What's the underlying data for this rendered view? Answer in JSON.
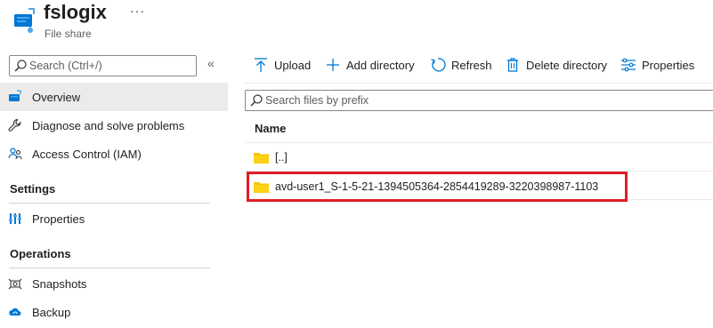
{
  "header": {
    "title": "fslogix",
    "subtitle": "File share",
    "more": "···"
  },
  "sidebar": {
    "search_placeholder": "Search (Ctrl+/)",
    "collapse": "«",
    "items": [
      {
        "label": "Overview",
        "icon": "file-share-icon",
        "selected": true
      },
      {
        "label": "Diagnose and solve problems",
        "icon": "wrench-icon"
      },
      {
        "label": "Access Control (IAM)",
        "icon": "people-icon"
      }
    ],
    "sections": [
      {
        "title": "Settings",
        "items": [
          {
            "label": "Properties",
            "icon": "properties-icon"
          }
        ]
      },
      {
        "title": "Operations",
        "items": [
          {
            "label": "Snapshots",
            "icon": "snapshot-icon"
          },
          {
            "label": "Backup",
            "icon": "backup-cloud-icon"
          }
        ]
      }
    ]
  },
  "toolbar": {
    "upload": "Upload",
    "add_directory": "Add directory",
    "refresh": "Refresh",
    "delete_directory": "Delete directory",
    "properties": "Properties"
  },
  "files": {
    "search_placeholder": "Search files by prefix",
    "column_name": "Name",
    "rows": [
      {
        "name": "[..]",
        "icon": "folder-icon"
      },
      {
        "name": "avd-user1_S-1-5-21-1394505364-2854419289-3220398987-1103",
        "icon": "folder-icon",
        "highlighted": true
      }
    ]
  },
  "colors": {
    "accent": "#0078d4",
    "folder": "#f8c400",
    "highlight_border": "#e01e27",
    "selected_bg": "#edebe9"
  }
}
